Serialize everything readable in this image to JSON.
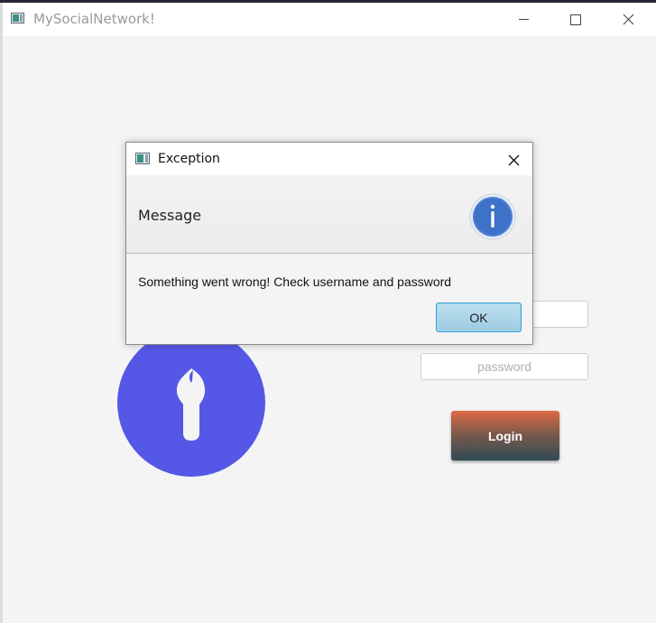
{
  "window": {
    "title": "MySocialNetwork!",
    "controls": {
      "minimize_icon": "minimize-icon",
      "maximize_icon": "maximize-icon",
      "close_icon": "close-icon"
    }
  },
  "login": {
    "username_placeholder": "",
    "password_placeholder": "password",
    "login_label": "Login",
    "logo_icon": "key-icon",
    "logo_color": "#5557e6",
    "button_gradient": [
      "#e06a43",
      "#2f4a55"
    ]
  },
  "dialog": {
    "title": "Exception",
    "header": "Message",
    "content": "Something went wrong! Check username and password",
    "ok_label": "OK",
    "info_icon": "info-icon",
    "info_color": "#3d72c9"
  }
}
